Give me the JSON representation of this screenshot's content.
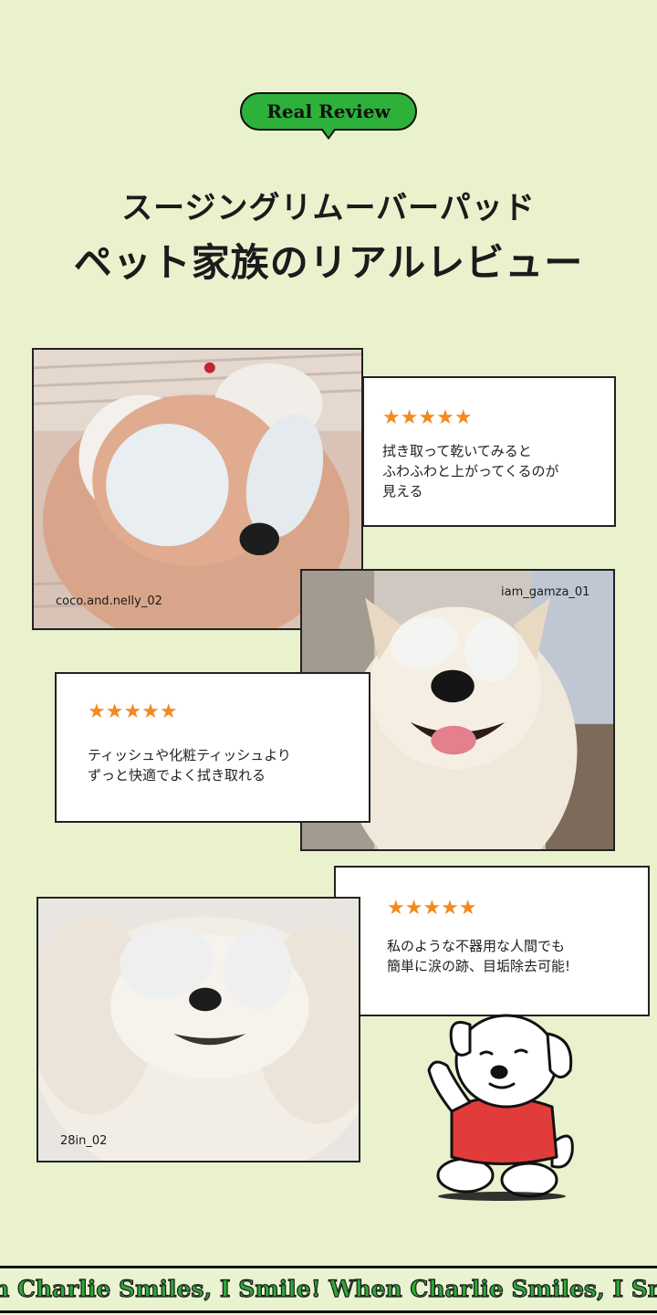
{
  "header": {
    "badge": "Real Review",
    "title_line1": "スージングリムーバーパッド",
    "title_line2": "ペット家族のリアルレビュー"
  },
  "reviews": [
    {
      "handle": "coco.and.nelly_02",
      "rating": 5,
      "stars": "★★★★★",
      "text": "拭き取って乾いてみると\nふわふわと上がってくるのが\n見える"
    },
    {
      "handle": "iam_gamza_01",
      "rating": 5,
      "stars": "★★★★★",
      "text": "ティッシュや化粧ティッシュより\nずっと快適でよく拭き取れる"
    },
    {
      "handle": "28in_02",
      "rating": 5,
      "stars": "★★★★★",
      "text": "私のような不器用な人間でも\n簡単に涙の跡、目垢除去可能!"
    }
  ],
  "footer": {
    "marquee": "hen Charlie Smiles, I Smile!   When Charlie Smiles, I Smi"
  },
  "colors": {
    "background": "#e9f2cd",
    "badge_green": "#2db13a",
    "star_orange": "#f28a1f",
    "marquee_green": "#2ea83b"
  }
}
